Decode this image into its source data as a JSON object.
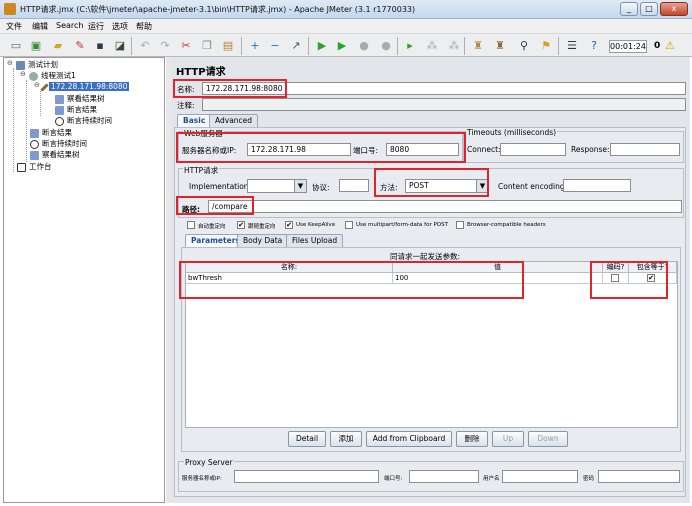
{
  "window": {
    "title": "HTTP请求.jmx (C:\\软件\\jmeter\\apache-jmeter-3.1\\bin\\HTTP请求.jmx) - Apache JMeter (3.1 r1770033)",
    "controls": [
      "_",
      "□",
      "x"
    ]
  },
  "menu": [
    "文件",
    "编辑",
    "Search",
    "运行",
    "选项",
    "帮助"
  ],
  "toolbar": {
    "elapsed": "00:01:24",
    "error_count": "0"
  },
  "tree": {
    "items": [
      {
        "label": "测试计划"
      },
      {
        "label": "线程测试1"
      },
      {
        "label": "172.28.171.98:8080"
      },
      {
        "label": "察看结果树"
      },
      {
        "label": "断言结果"
      },
      {
        "label": "断言持续时间"
      },
      {
        "label": "断言结果"
      },
      {
        "label": "断言持续时间"
      },
      {
        "label": "察看结果树"
      },
      {
        "label": "工作台"
      }
    ]
  },
  "panel": {
    "heading": "HTTP请求",
    "name_label": "名称:",
    "name_value": "172.28.171.98:8080",
    "comment_label": "注释:",
    "tabs": [
      "Basic",
      "Advanced"
    ],
    "web_server": {
      "group_title": "Web服务器",
      "server_label": "服务器名称或IP:",
      "server_value": "172.28.171.98",
      "port_label": "端口号:",
      "port_value": "8080"
    },
    "timeouts": {
      "group_title": "Timeouts (milliseconds)",
      "connect_label": "Connect:",
      "response_label": "Response:"
    },
    "http_request": {
      "group_title": "HTTP请求",
      "implementation_label": "Implementation:",
      "protocol_label": "协议:",
      "method_label": "方法:",
      "method_value": "POST",
      "encoding_label": "Content encoding:",
      "path_label": "路径:",
      "path_value": "/compare"
    },
    "checkboxes": [
      {
        "label": "自动重定向",
        "checked": false
      },
      {
        "label": "跟随重定向",
        "checked": true
      },
      {
        "label": "Use KeepAlive",
        "checked": true
      },
      {
        "label": "Use multipart/form-data for POST",
        "checked": false
      },
      {
        "label": "Browser-compatible headers",
        "checked": false
      }
    ],
    "param_tabs": [
      "Parameters",
      "Body Data",
      "Files Upload"
    ],
    "params_title": "同请求一起发送参数:",
    "params_columns": [
      "名称:",
      "值",
      "编码?",
      "包含等于?"
    ],
    "params_rows": [
      {
        "name": "bwThresh",
        "value": "100",
        "encode": false,
        "include_equals": true
      }
    ],
    "buttons": [
      "Detail",
      "添加",
      "Add from Clipboard",
      "删除",
      "Up",
      "Down"
    ],
    "proxy": {
      "group_title": "Proxy Server",
      "server_label": "服务器名称或IP:",
      "port_label": "端口号:",
      "user_label": "用户名",
      "password_label": "密码"
    }
  }
}
